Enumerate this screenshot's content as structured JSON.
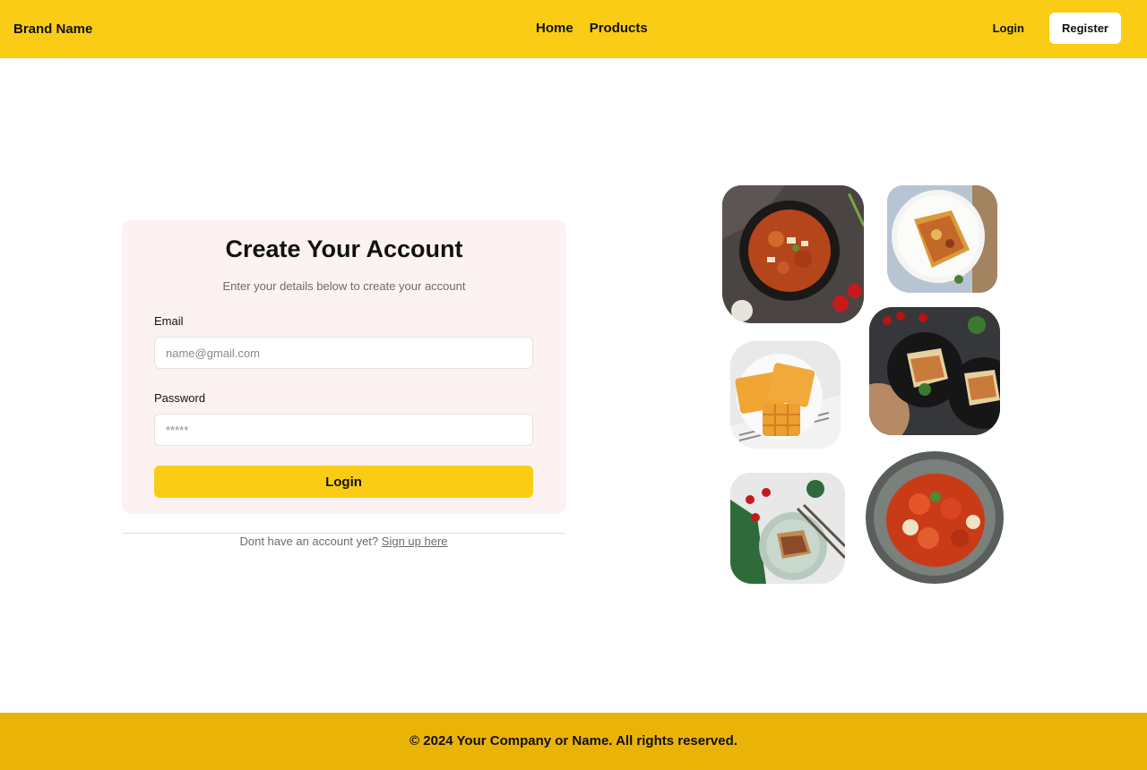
{
  "nav": {
    "brand": "Brand Name",
    "links": [
      "Home",
      "Products"
    ],
    "login": "Login",
    "register": "Register"
  },
  "form": {
    "title": "Create Your Account",
    "subtitle": "Enter your details below to create your account",
    "email_label": "Email",
    "email_placeholder": "name@gmail.com",
    "password_label": "Password",
    "password_placeholder": "*****",
    "submit": "Login"
  },
  "signup": {
    "text": "Dont have an account yet?",
    "link": "Sign up here"
  },
  "gallery": [
    {
      "name": "tikka-masala-photo"
    },
    {
      "name": "lasagna-plate-photo"
    },
    {
      "name": "lasagna-dark-plates-photo"
    },
    {
      "name": "waffles-photo"
    },
    {
      "name": "lasagna-green-plate-photo"
    },
    {
      "name": "pasta-bowl-photo"
    }
  ],
  "footer": {
    "text": "© 2024 Your Company or Name. All rights reserved."
  },
  "colors": {
    "navbar": "#facc15",
    "footer": "#eab308",
    "card": "#fdf2f2",
    "button": "#facc15"
  }
}
